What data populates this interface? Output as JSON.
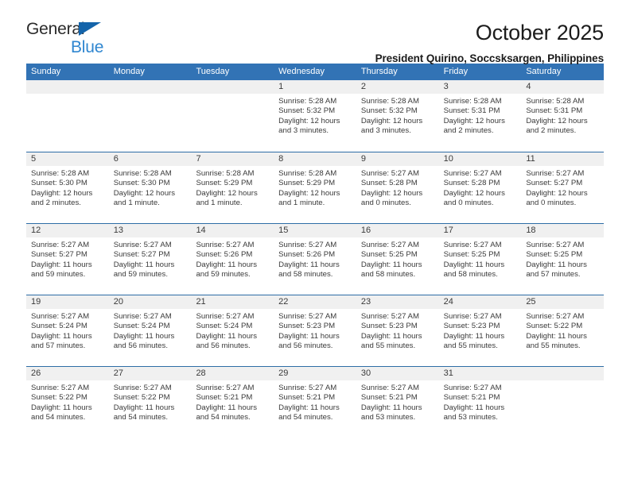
{
  "logo": {
    "line1": "General",
    "line2": "Blue",
    "triangle_color": "#1464aa",
    "blue_text_color": "#2f86d0"
  },
  "header": {
    "title": "October 2025",
    "subtitle": "President Quirino, Soccsksargen, Philippines"
  },
  "theme": {
    "header_row_bg": "#3273b5",
    "row_divider": "#2e6da6",
    "date_strip_bg": "#f0f0f0",
    "text_color": "#3a3a3a"
  },
  "weekdays": [
    "Sunday",
    "Monday",
    "Tuesday",
    "Wednesday",
    "Thursday",
    "Friday",
    "Saturday"
  ],
  "weeks": [
    [
      {
        "day": "",
        "lines": []
      },
      {
        "day": "",
        "lines": []
      },
      {
        "day": "",
        "lines": []
      },
      {
        "day": "1",
        "lines": [
          "Sunrise: 5:28 AM",
          "Sunset: 5:32 PM",
          "Daylight: 12 hours",
          "and 3 minutes."
        ]
      },
      {
        "day": "2",
        "lines": [
          "Sunrise: 5:28 AM",
          "Sunset: 5:32 PM",
          "Daylight: 12 hours",
          "and 3 minutes."
        ]
      },
      {
        "day": "3",
        "lines": [
          "Sunrise: 5:28 AM",
          "Sunset: 5:31 PM",
          "Daylight: 12 hours",
          "and 2 minutes."
        ]
      },
      {
        "day": "4",
        "lines": [
          "Sunrise: 5:28 AM",
          "Sunset: 5:31 PM",
          "Daylight: 12 hours",
          "and 2 minutes."
        ]
      }
    ],
    [
      {
        "day": "5",
        "lines": [
          "Sunrise: 5:28 AM",
          "Sunset: 5:30 PM",
          "Daylight: 12 hours",
          "and 2 minutes."
        ]
      },
      {
        "day": "6",
        "lines": [
          "Sunrise: 5:28 AM",
          "Sunset: 5:30 PM",
          "Daylight: 12 hours",
          "and 1 minute."
        ]
      },
      {
        "day": "7",
        "lines": [
          "Sunrise: 5:28 AM",
          "Sunset: 5:29 PM",
          "Daylight: 12 hours",
          "and 1 minute."
        ]
      },
      {
        "day": "8",
        "lines": [
          "Sunrise: 5:28 AM",
          "Sunset: 5:29 PM",
          "Daylight: 12 hours",
          "and 1 minute."
        ]
      },
      {
        "day": "9",
        "lines": [
          "Sunrise: 5:27 AM",
          "Sunset: 5:28 PM",
          "Daylight: 12 hours",
          "and 0 minutes."
        ]
      },
      {
        "day": "10",
        "lines": [
          "Sunrise: 5:27 AM",
          "Sunset: 5:28 PM",
          "Daylight: 12 hours",
          "and 0 minutes."
        ]
      },
      {
        "day": "11",
        "lines": [
          "Sunrise: 5:27 AM",
          "Sunset: 5:27 PM",
          "Daylight: 12 hours",
          "and 0 minutes."
        ]
      }
    ],
    [
      {
        "day": "12",
        "lines": [
          "Sunrise: 5:27 AM",
          "Sunset: 5:27 PM",
          "Daylight: 11 hours",
          "and 59 minutes."
        ]
      },
      {
        "day": "13",
        "lines": [
          "Sunrise: 5:27 AM",
          "Sunset: 5:27 PM",
          "Daylight: 11 hours",
          "and 59 minutes."
        ]
      },
      {
        "day": "14",
        "lines": [
          "Sunrise: 5:27 AM",
          "Sunset: 5:26 PM",
          "Daylight: 11 hours",
          "and 59 minutes."
        ]
      },
      {
        "day": "15",
        "lines": [
          "Sunrise: 5:27 AM",
          "Sunset: 5:26 PM",
          "Daylight: 11 hours",
          "and 58 minutes."
        ]
      },
      {
        "day": "16",
        "lines": [
          "Sunrise: 5:27 AM",
          "Sunset: 5:25 PM",
          "Daylight: 11 hours",
          "and 58 minutes."
        ]
      },
      {
        "day": "17",
        "lines": [
          "Sunrise: 5:27 AM",
          "Sunset: 5:25 PM",
          "Daylight: 11 hours",
          "and 58 minutes."
        ]
      },
      {
        "day": "18",
        "lines": [
          "Sunrise: 5:27 AM",
          "Sunset: 5:25 PM",
          "Daylight: 11 hours",
          "and 57 minutes."
        ]
      }
    ],
    [
      {
        "day": "19",
        "lines": [
          "Sunrise: 5:27 AM",
          "Sunset: 5:24 PM",
          "Daylight: 11 hours",
          "and 57 minutes."
        ]
      },
      {
        "day": "20",
        "lines": [
          "Sunrise: 5:27 AM",
          "Sunset: 5:24 PM",
          "Daylight: 11 hours",
          "and 56 minutes."
        ]
      },
      {
        "day": "21",
        "lines": [
          "Sunrise: 5:27 AM",
          "Sunset: 5:24 PM",
          "Daylight: 11 hours",
          "and 56 minutes."
        ]
      },
      {
        "day": "22",
        "lines": [
          "Sunrise: 5:27 AM",
          "Sunset: 5:23 PM",
          "Daylight: 11 hours",
          "and 56 minutes."
        ]
      },
      {
        "day": "23",
        "lines": [
          "Sunrise: 5:27 AM",
          "Sunset: 5:23 PM",
          "Daylight: 11 hours",
          "and 55 minutes."
        ]
      },
      {
        "day": "24",
        "lines": [
          "Sunrise: 5:27 AM",
          "Sunset: 5:23 PM",
          "Daylight: 11 hours",
          "and 55 minutes."
        ]
      },
      {
        "day": "25",
        "lines": [
          "Sunrise: 5:27 AM",
          "Sunset: 5:22 PM",
          "Daylight: 11 hours",
          "and 55 minutes."
        ]
      }
    ],
    [
      {
        "day": "26",
        "lines": [
          "Sunrise: 5:27 AM",
          "Sunset: 5:22 PM",
          "Daylight: 11 hours",
          "and 54 minutes."
        ]
      },
      {
        "day": "27",
        "lines": [
          "Sunrise: 5:27 AM",
          "Sunset: 5:22 PM",
          "Daylight: 11 hours",
          "and 54 minutes."
        ]
      },
      {
        "day": "28",
        "lines": [
          "Sunrise: 5:27 AM",
          "Sunset: 5:21 PM",
          "Daylight: 11 hours",
          "and 54 minutes."
        ]
      },
      {
        "day": "29",
        "lines": [
          "Sunrise: 5:27 AM",
          "Sunset: 5:21 PM",
          "Daylight: 11 hours",
          "and 54 minutes."
        ]
      },
      {
        "day": "30",
        "lines": [
          "Sunrise: 5:27 AM",
          "Sunset: 5:21 PM",
          "Daylight: 11 hours",
          "and 53 minutes."
        ]
      },
      {
        "day": "31",
        "lines": [
          "Sunrise: 5:27 AM",
          "Sunset: 5:21 PM",
          "Daylight: 11 hours",
          "and 53 minutes."
        ]
      },
      {
        "day": "",
        "lines": []
      }
    ]
  ]
}
